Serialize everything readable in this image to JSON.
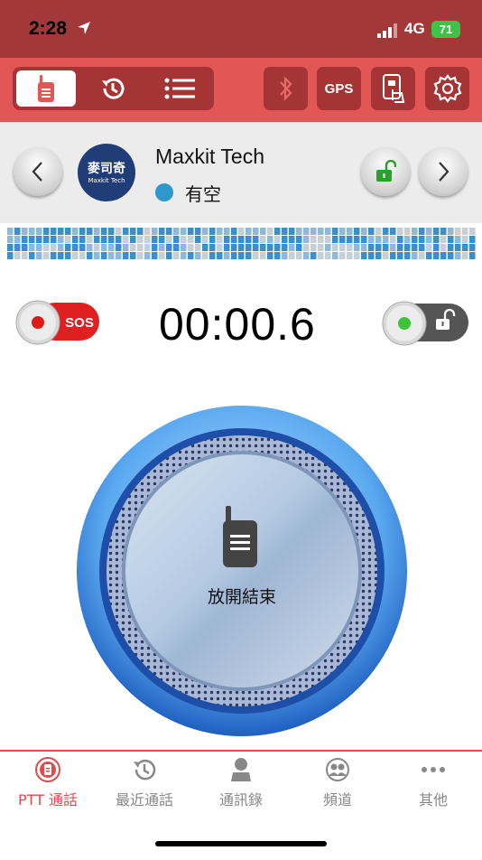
{
  "status_bar": {
    "time": "2:28",
    "network": "4G",
    "battery": "71"
  },
  "toolbar": {
    "segments": [
      "ptt-icon",
      "history-icon",
      "list-icon"
    ],
    "selected_segment": 0,
    "gps_label": "GPS",
    "buttons": [
      "bluetooth-icon",
      "gps",
      "phone-touch-icon",
      "gear-icon"
    ]
  },
  "contact": {
    "avatar_text_cn": "麥司奇",
    "avatar_text_en": "Maxkit Tech",
    "name": "Maxkit Tech",
    "status": "有空",
    "status_color": "#2e98cc"
  },
  "controls": {
    "sos_label": "SOS",
    "timer": "00:00.6"
  },
  "ptt": {
    "label": "放開結束"
  },
  "tabs": [
    {
      "label": "PTT 通話",
      "icon": "ptt-tab-icon",
      "active": true
    },
    {
      "label": "最近通話",
      "icon": "history-icon",
      "active": false
    },
    {
      "label": "通訊錄",
      "icon": "person-icon",
      "active": false
    },
    {
      "label": "頻道",
      "icon": "group-icon",
      "active": false
    },
    {
      "label": "其他",
      "icon": "more-icon",
      "active": false
    }
  ],
  "colors": {
    "status_bar": "#a33838",
    "toolbar": "#e35656",
    "active_tab": "#e04b4b",
    "accent_blue": "#2e98cc"
  }
}
